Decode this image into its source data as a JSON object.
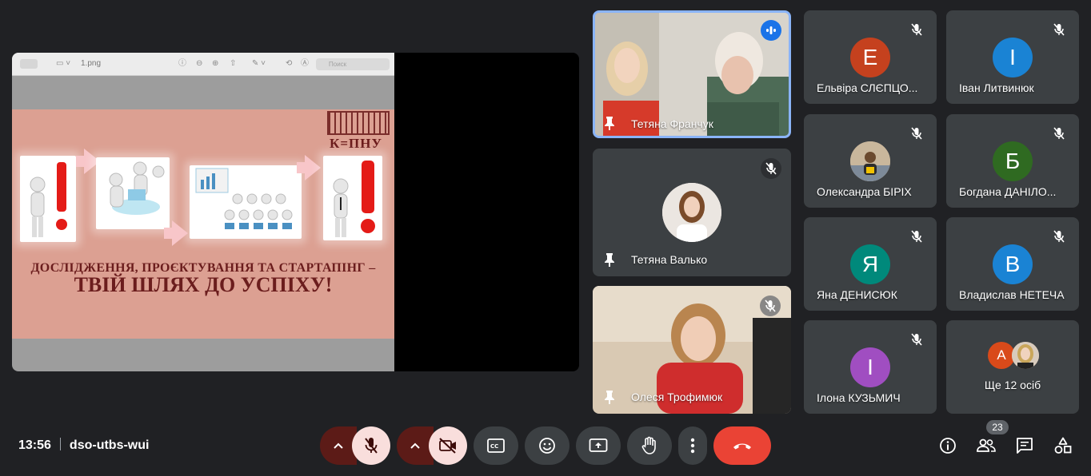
{
  "presentation": {
    "viewer_filename": "1.png",
    "viewer_search_placeholder": "Поиск",
    "slide_logo": "К=ПНУ",
    "slide_line1": "ДОСЛІДЖЕННЯ, ПРОЄКТУВАННЯ ТА СТАРТАПІНГ –",
    "slide_line2": "ТВІЙ ШЛЯХ ДО УСПІХУ!"
  },
  "tiles": [
    {
      "name": "Тетяна Франчук"
    },
    {
      "name": "Тетяна Валько"
    },
    {
      "name": "Олеся Трофимюк"
    }
  ],
  "grid": [
    {
      "name": "Ельвіра СЛЄПЦО...",
      "initial": "Е",
      "color": "#c5411e"
    },
    {
      "name": "Іван Литвинюк",
      "initial": "І",
      "color": "#1a83d4"
    },
    {
      "name": "Олександра БІРІХ",
      "initial": "",
      "color": "#b8a58a"
    },
    {
      "name": "Богдана ДАНІЛО...",
      "initial": "Б",
      "color": "#2f6a21"
    },
    {
      "name": "Яна ДЕНИСЮК",
      "initial": "Я",
      "color": "#00897b"
    },
    {
      "name": "Владислав НЕТЕЧА",
      "initial": "В",
      "color": "#1a83d4"
    },
    {
      "name": "Ілона КУЗЬМИЧ",
      "initial": "І",
      "color": "#a04ec1"
    }
  ],
  "others": {
    "label": "Ще 12 осіб",
    "initial": "A",
    "color": "#d94a1a"
  },
  "meeting": {
    "time": "13:56",
    "code": "dso-utbs-wui"
  },
  "participants_count": "23",
  "colors": {
    "background": "#202124",
    "tile": "#3c4043",
    "hangup": "#ea4335",
    "speaking_border": "#8ab4f8"
  }
}
